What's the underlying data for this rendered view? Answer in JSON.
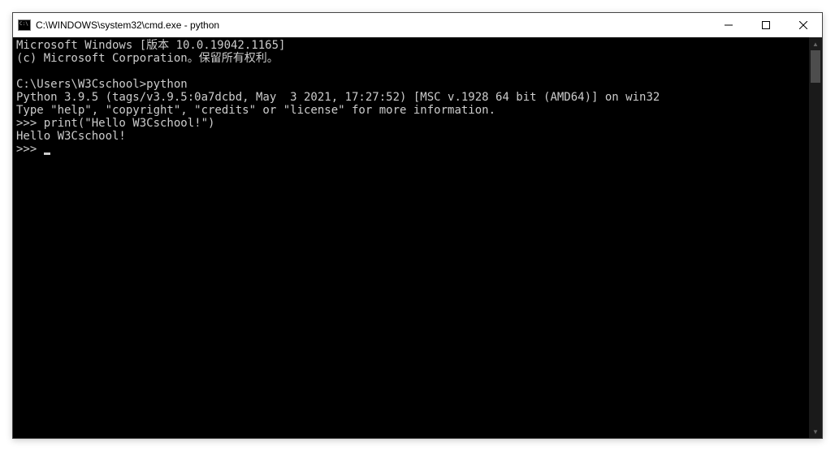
{
  "window": {
    "title": "C:\\WINDOWS\\system32\\cmd.exe - python"
  },
  "terminal": {
    "lines": [
      "Microsoft Windows [版本 10.0.19042.1165]",
      "(c) Microsoft Corporation。保留所有权利。",
      "",
      "C:\\Users\\W3Cschool>python",
      "Python 3.9.5 (tags/v3.9.5:0a7dcbd, May  3 2021, 17:27:52) [MSC v.1928 64 bit (AMD64)] on win32",
      "Type \"help\", \"copyright\", \"credits\" or \"license\" for more information.",
      ">>> print(\"Hello W3Cschool!\")",
      "Hello W3Cschool!",
      ">>> "
    ]
  }
}
